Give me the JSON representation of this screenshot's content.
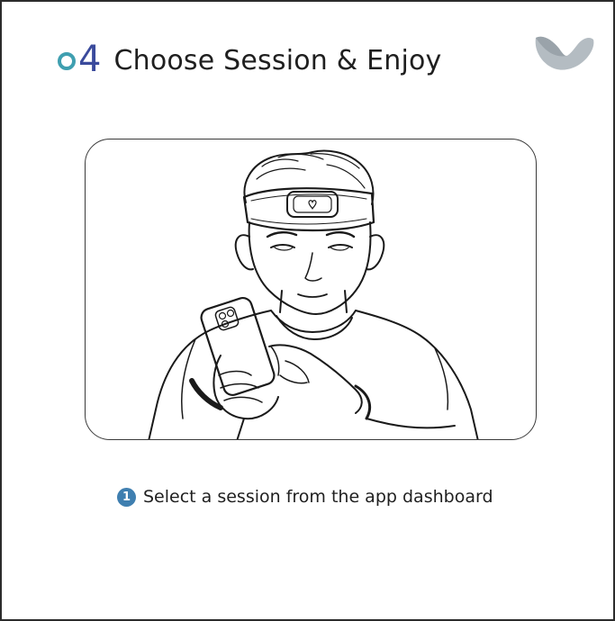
{
  "header": {
    "step_number": "4",
    "title": "Choose Session & Enjoy"
  },
  "logo": {
    "icon": "brand-heart-logo-icon",
    "color": "#b4bcc2"
  },
  "illustration": {
    "icon": "man-wearing-eye-mask-using-phone-illustration"
  },
  "instruction": {
    "badge": "1",
    "text": "Select a session from the app dashboard"
  },
  "colors": {
    "step_zero": "#3f9fb0",
    "step_four": "#3a4a9c",
    "badge": "#3f7fb0",
    "text": "#1f1f1f"
  }
}
